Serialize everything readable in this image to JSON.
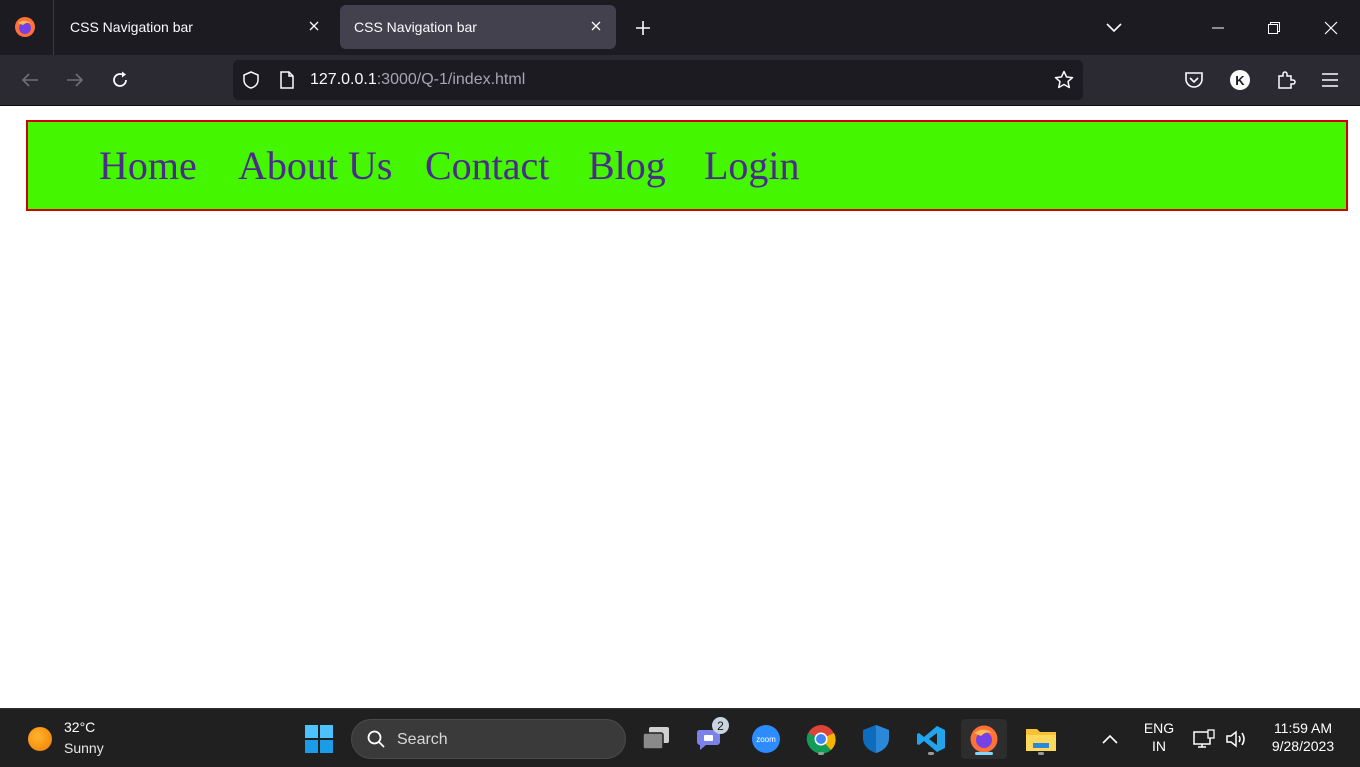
{
  "browser": {
    "tabs": [
      {
        "title": "CSS Navigation bar",
        "active": false
      },
      {
        "title": "CSS Navigation bar",
        "active": true
      }
    ],
    "url": {
      "host": "127.0.0.1",
      "rest": ":3000/Q-1/index.html"
    },
    "profile_initial": "K"
  },
  "nav": {
    "links": [
      "Home",
      "About Us",
      "Contact",
      "Blog",
      "Login"
    ]
  },
  "colors": {
    "navbar_bg": "#44f700",
    "navbar_border": "#d00000",
    "link_color": "#4b2b8c"
  },
  "taskbar": {
    "weather": {
      "temp": "32°C",
      "condition": "Sunny"
    },
    "search_label": "Search",
    "teams_badge": "2",
    "zoom_label": "zoom",
    "language": {
      "line1": "ENG",
      "line2": "IN"
    },
    "clock": {
      "time": "11:59 AM",
      "date": "9/28/2023"
    }
  }
}
